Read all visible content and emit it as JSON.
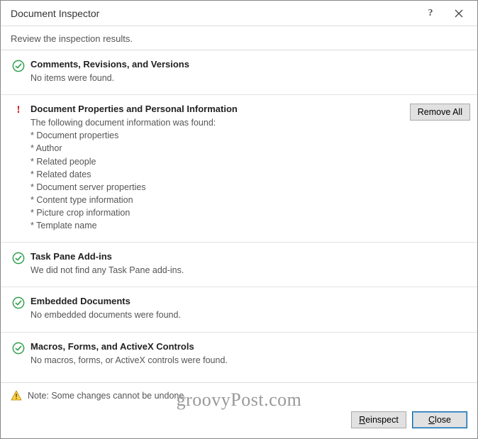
{
  "title": "Document Inspector",
  "subheader": "Review the inspection results.",
  "sections": [
    {
      "status": "ok",
      "title": "Comments, Revisions, and Versions",
      "msg": "No items were found."
    },
    {
      "status": "warn",
      "title": "Document Properties and Personal Information",
      "msg": "The following document information was found:",
      "items": [
        "* Document properties",
        "* Author",
        "* Related people",
        "* Related dates",
        "* Document server properties",
        "* Content type information",
        "* Picture crop information",
        "* Template name"
      ],
      "action": "Remove All"
    },
    {
      "status": "ok",
      "title": "Task Pane Add-ins",
      "msg": "We did not find any Task Pane add-ins."
    },
    {
      "status": "ok",
      "title": "Embedded Documents",
      "msg": "No embedded documents were found."
    },
    {
      "status": "ok",
      "title": "Macros, Forms, and ActiveX Controls",
      "msg": "No macros, forms, or ActiveX controls were found."
    }
  ],
  "note": "Note: Some changes cannot be undone.",
  "buttons": {
    "reinspect": "Reinspect",
    "close": "Close"
  },
  "watermark": "groovyPost.com"
}
